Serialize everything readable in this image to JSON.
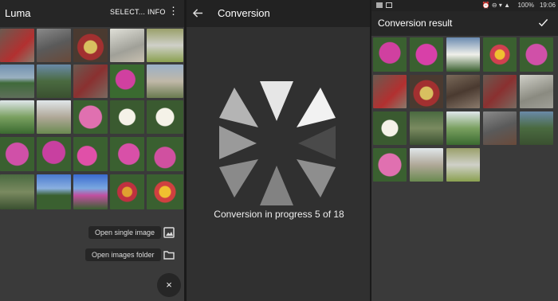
{
  "left": {
    "app_title": "Luma",
    "select_label": "SELECT...",
    "info_label": "INFO",
    "more_icon": "more-vert-icon",
    "open_single_label": "Open single image",
    "open_folder_label": "Open images folder",
    "image_icon": "image-icon",
    "folder_icon": "folder-icon",
    "close_icon": "close-icon",
    "close_glyph": "×"
  },
  "middle": {
    "title": "Conversion",
    "back_icon": "arrow-back-icon",
    "progress_text": "Conversion in progress 5 of 18",
    "spinner_icon": "loading-spinner-icon"
  },
  "right": {
    "status": {
      "left_text": "",
      "battery": "100%",
      "time": "19:06"
    },
    "title": "Conversion result",
    "check_icon": "check-icon"
  },
  "colors": {
    "toolbar": "#262626",
    "panel": "#3a3a3a"
  }
}
